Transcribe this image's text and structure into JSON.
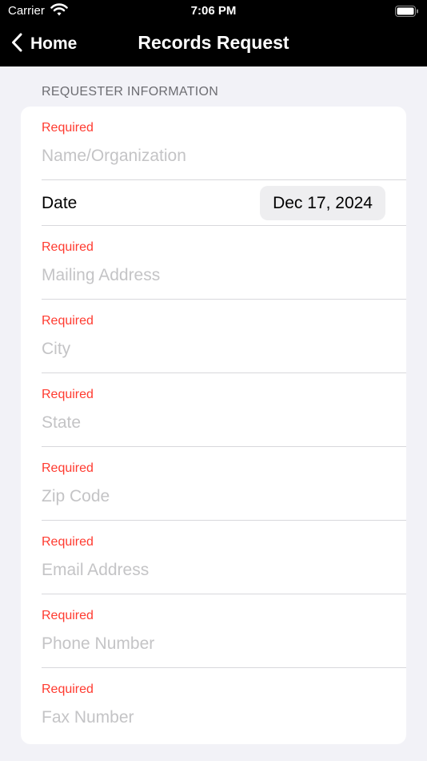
{
  "status_bar": {
    "carrier": "Carrier",
    "time": "7:06 PM"
  },
  "nav": {
    "back_label": "Home",
    "title": "Records Request"
  },
  "section": {
    "header": "REQUESTER INFORMATION"
  },
  "form": {
    "required_label": "Required",
    "name": {
      "placeholder": "Name/Organization",
      "value": ""
    },
    "date": {
      "label": "Date",
      "value": "Dec 17, 2024"
    },
    "mailing_address": {
      "placeholder": "Mailing Address",
      "value": ""
    },
    "city": {
      "placeholder": "City",
      "value": ""
    },
    "state": {
      "placeholder": "State",
      "value": ""
    },
    "zip_code": {
      "placeholder": "Zip Code",
      "value": ""
    },
    "email": {
      "placeholder": "Email Address",
      "value": ""
    },
    "phone": {
      "placeholder": "Phone Number",
      "value": ""
    },
    "fax": {
      "placeholder": "Fax Number",
      "value": ""
    }
  },
  "icons": {
    "wifi": "wifi-icon",
    "battery": "battery-icon",
    "back": "chevron-left-icon"
  },
  "colors": {
    "required": "#ff3b30",
    "nav_background": "#000000",
    "page_background": "#f2f2f7",
    "placeholder": "#c4c4c6"
  }
}
